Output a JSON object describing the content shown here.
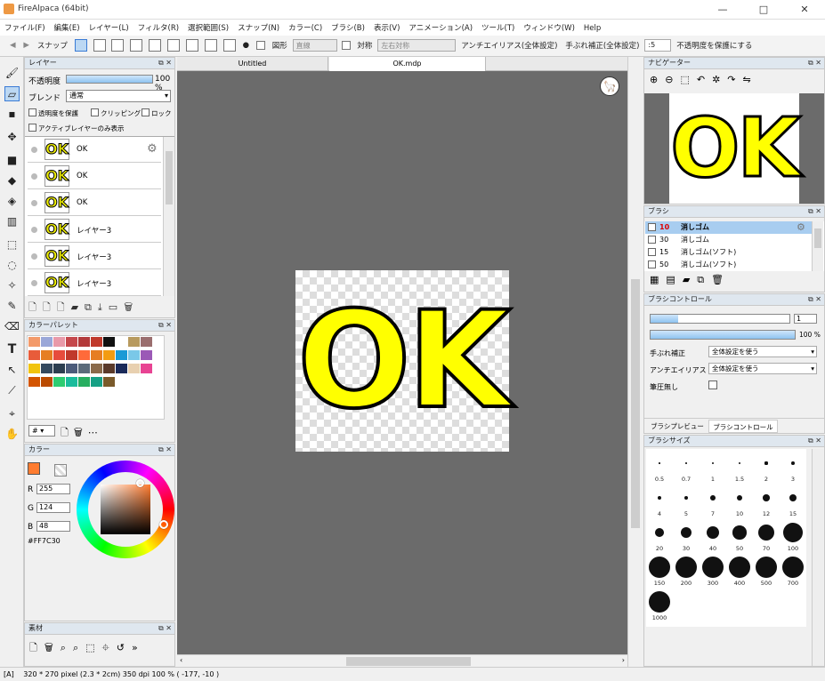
{
  "title": "FireAlpaca (64bit)",
  "window_buttons": [
    "—",
    "□",
    "✕"
  ],
  "menu": [
    "ファイル(F)",
    "編集(E)",
    "レイヤー(L)",
    "フィルタ(R)",
    "選択範囲(S)",
    "スナップ(N)",
    "カラー(C)",
    "ブラシ(B)",
    "表示(V)",
    "アニメーション(A)",
    "ツール(T)",
    "ウィンドウ(W)",
    "Help"
  ],
  "toolbar": {
    "snap_label": "スナップ",
    "shape_label": "図形",
    "shape_value": "直線",
    "symmetry_label": "対称",
    "symmetry_value": "左右対称",
    "antialias_label": "アンチエイリアス(全体設定)",
    "correction_label": "手ぶれ補正(全体設定)",
    "correction_value": ":5",
    "keep_opacity_label": "不透明度を保護にする"
  },
  "layer_panel": {
    "title": "レイヤー",
    "opacity_label": "不透明度",
    "opacity_value": "100 %",
    "opacity_fraction": 1.0,
    "blend_label": "ブレンド",
    "blend_value": "通常",
    "protect_alpha": "透明度を保護",
    "clipping": "クリッピング",
    "lock": "ロック",
    "active_only": "アクティブレイヤーのみ表示",
    "layers": [
      {
        "name": "OK",
        "selected": true
      },
      {
        "name": "OK",
        "selected": false
      },
      {
        "name": "OK",
        "selected": false
      },
      {
        "name": "レイヤー3",
        "selected": false
      },
      {
        "name": "レイヤー3",
        "selected": false
      },
      {
        "name": "レイヤー3",
        "selected": false
      }
    ]
  },
  "color_palette": {
    "title": "カラーパレット",
    "selector_value": "#",
    "swatches": [
      "#f39a6a",
      "#9aa7d8",
      "#e99aa9",
      "#c5474b",
      "#b33a3a",
      "#c0392b",
      "#111111",
      "#ffffff",
      "#b89a5e",
      "#9a6e6e",
      "#e85c3a",
      "#e67e22",
      "#e74c3c",
      "#c0392b",
      "#ff6a3a",
      "#e67e22",
      "#f39c12",
      "#1a9ad6",
      "#7ac8e8",
      "#9b59b6",
      "#f1c40f",
      "#34495e",
      "#2c3e50",
      "#4b5b7a",
      "#5b6b7a",
      "#8a6a4a",
      "#5a3a2a",
      "#1a2a5a",
      "#e8d0b0",
      "#e84393",
      "#d35400",
      "#ba4a00",
      "#2ecc71",
      "#1abc9c",
      "#27ae60",
      "#16a085",
      "#7a5a2a"
    ]
  },
  "color_panel": {
    "title": "カラー",
    "r_label": "R",
    "g_label": "G",
    "b_label": "B",
    "r_value": "255",
    "g_value": "124",
    "b_value": "48",
    "hex": "#FF7C30",
    "primary": "#ff7c30"
  },
  "material_panel": {
    "title": "素材"
  },
  "canvas": {
    "tabs": [
      "Untitled",
      "OK.mdp"
    ],
    "text": "OK",
    "fill": "#ffff00",
    "bg": "#6b6b6b"
  },
  "navigator": {
    "title": "ナビゲーター",
    "text": "OK"
  },
  "brush_panel": {
    "title": "ブラシ",
    "items": [
      {
        "size": "10",
        "name": "消しゴム",
        "selected": true
      },
      {
        "size": "30",
        "name": "消しゴム",
        "selected": false
      },
      {
        "size": "15",
        "name": "消しゴム(ソフト)",
        "selected": false
      },
      {
        "size": "50",
        "name": "消しゴム(ソフト)",
        "selected": false
      }
    ]
  },
  "brush_control": {
    "title": "ブラシコントロール",
    "size_value": "1",
    "opacity_value": "100 %",
    "correction_label": "手ぶれ補正",
    "correction_value": "全体設定を使う",
    "antialias_label": "アンチエイリアス",
    "antialias_value": "全体設定を使う",
    "pressure_label": "筆圧無し",
    "size_fraction": 0.2,
    "opacity_fraction": 1.0
  },
  "tabs_bottom": [
    "ブラシプレビュー",
    "ブラシコントロール"
  ],
  "brush_size": {
    "title": "ブラシサイズ",
    "sizes": [
      "0.5",
      "0.7",
      "1",
      "1.5",
      "2",
      "3",
      "4",
      "5",
      "7",
      "10",
      "12",
      "15",
      "20",
      "30",
      "40",
      "50",
      "70",
      "100",
      "150",
      "200",
      "300",
      "400",
      "500",
      "700",
      "1000"
    ]
  },
  "status": {
    "mode": "[A]",
    "info": "320 * 270 pixel   (2.3 * 2cm)   350 dpi   100 %   ( -177, -10 )"
  }
}
